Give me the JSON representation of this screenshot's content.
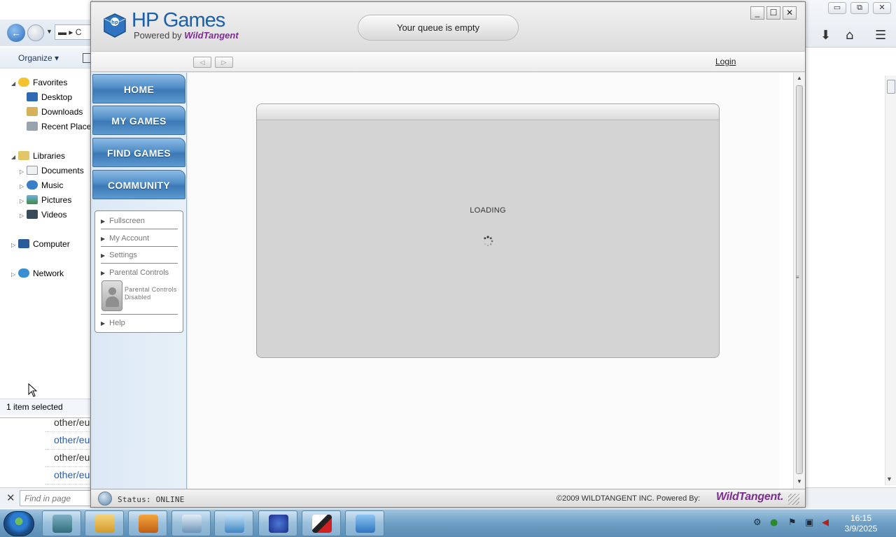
{
  "browser": {
    "links": [
      "other/eu",
      "other/eu",
      "other/eu",
      "other/eu"
    ],
    "find_placeholder": "Find in page"
  },
  "explorer": {
    "address_text": "C",
    "organize_label": "Organize",
    "tree": {
      "favorites": "Favorites",
      "desktop": "Desktop",
      "downloads": "Downloads",
      "recent_places": "Recent Places",
      "libraries": "Libraries",
      "documents": "Documents",
      "music": "Music",
      "pictures": "Pictures",
      "videos": "Videos",
      "computer": "Computer",
      "network": "Network"
    },
    "status": "1 item selected"
  },
  "hp": {
    "logo_title": "HP Games",
    "logo_powered": "Powered by",
    "logo_brand": "WildTangent",
    "queue": "Your queue is empty",
    "login": "Login",
    "nav": {
      "home": "HOME",
      "my_games": "MY GAMES",
      "find_games": "FIND GAMES",
      "community": "COMMUNITY"
    },
    "menu": {
      "fullscreen": "Fullscreen",
      "my_account": "My Account",
      "settings": "Settings",
      "parental_controls": "Parental Controls",
      "parental_status": "Parental Controls Disabled",
      "help": "Help"
    },
    "loading": "LOADING",
    "status": "Status: ONLINE",
    "copyright": "©2009 WILDTANGENT INC. Powered By:",
    "brand": "WildTangent."
  },
  "taskbar": {
    "time": "16:15",
    "date": "3/9/2025"
  }
}
